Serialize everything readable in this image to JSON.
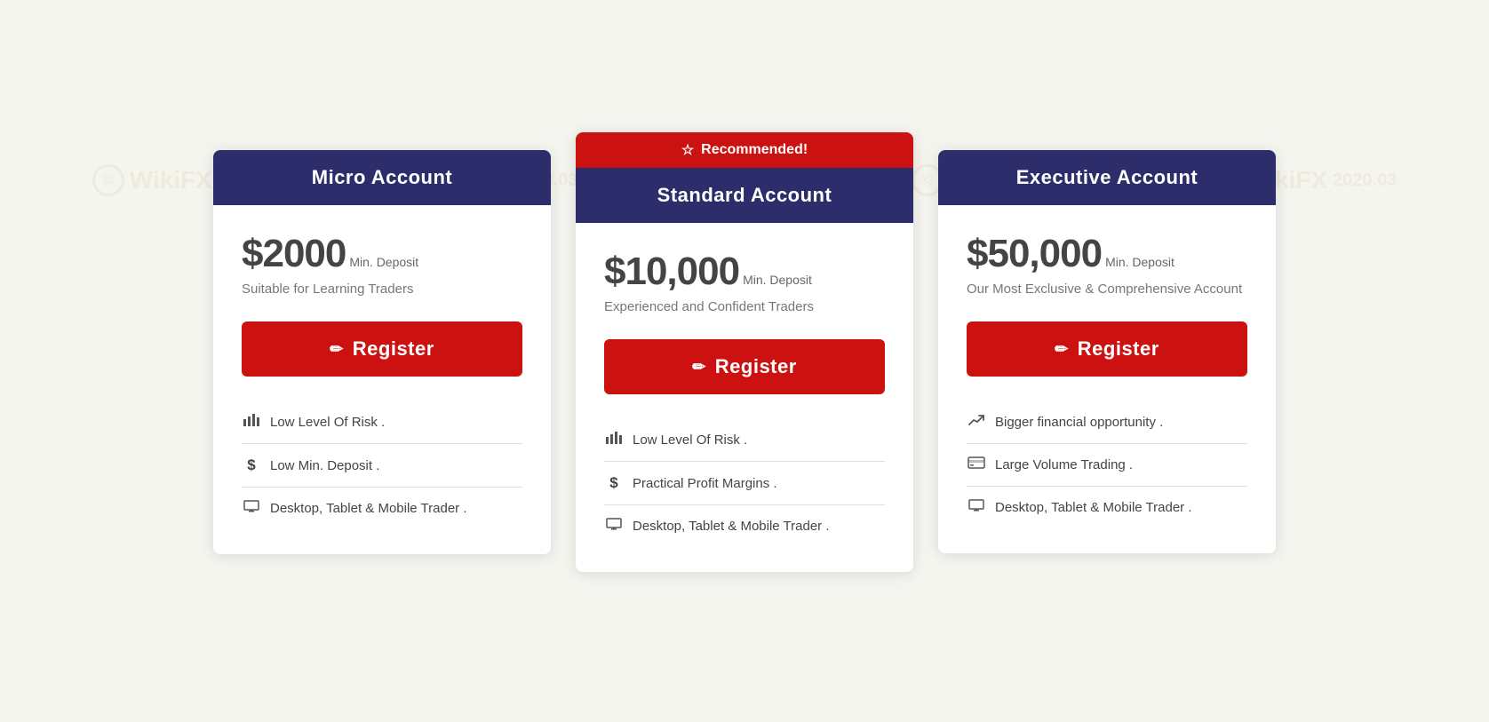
{
  "watermark": {
    "text": "WikiFX",
    "date": "2020.03"
  },
  "cards": [
    {
      "id": "micro",
      "header": "Micro Account",
      "recommended": false,
      "price_main": "$2000",
      "price_sub": "Min. Deposit",
      "description": "Suitable for Learning Traders",
      "register_label": "Register",
      "features": [
        {
          "icon": "bar-chart",
          "text": "Low Level Of Risk ."
        },
        {
          "icon": "dollar",
          "text": "Low Min. Deposit ."
        },
        {
          "icon": "monitor",
          "text": "Desktop, Tablet & Mobile Trader ."
        }
      ]
    },
    {
      "id": "standard",
      "header": "Standard Account",
      "recommended": true,
      "recommended_label": "Recommended!",
      "price_main": "$10,000",
      "price_sub": "Min. Deposit",
      "description": "Experienced and Confident Traders",
      "register_label": "Register",
      "features": [
        {
          "icon": "bar-chart",
          "text": "Low Level Of Risk ."
        },
        {
          "icon": "dollar",
          "text": "Practical Profit Margins ."
        },
        {
          "icon": "monitor",
          "text": "Desktop, Tablet & Mobile Trader ."
        }
      ]
    },
    {
      "id": "executive",
      "header": "Executive Account",
      "recommended": false,
      "price_main": "$50,000",
      "price_sub": "Min. Deposit",
      "description": "Our Most Exclusive & Comprehensive Account",
      "register_label": "Register",
      "features": [
        {
          "icon": "trend-up",
          "text": "Bigger financial opportunity ."
        },
        {
          "icon": "credit-card",
          "text": "Large Volume Trading ."
        },
        {
          "icon": "monitor",
          "text": "Desktop, Tablet & Mobile Trader ."
        }
      ]
    }
  ],
  "icons": {
    "bar-chart": "📊",
    "dollar": "$",
    "monitor": "▭",
    "trend-up": "↗",
    "credit-card": "🖥",
    "star": "☆",
    "pencil": "✏"
  }
}
